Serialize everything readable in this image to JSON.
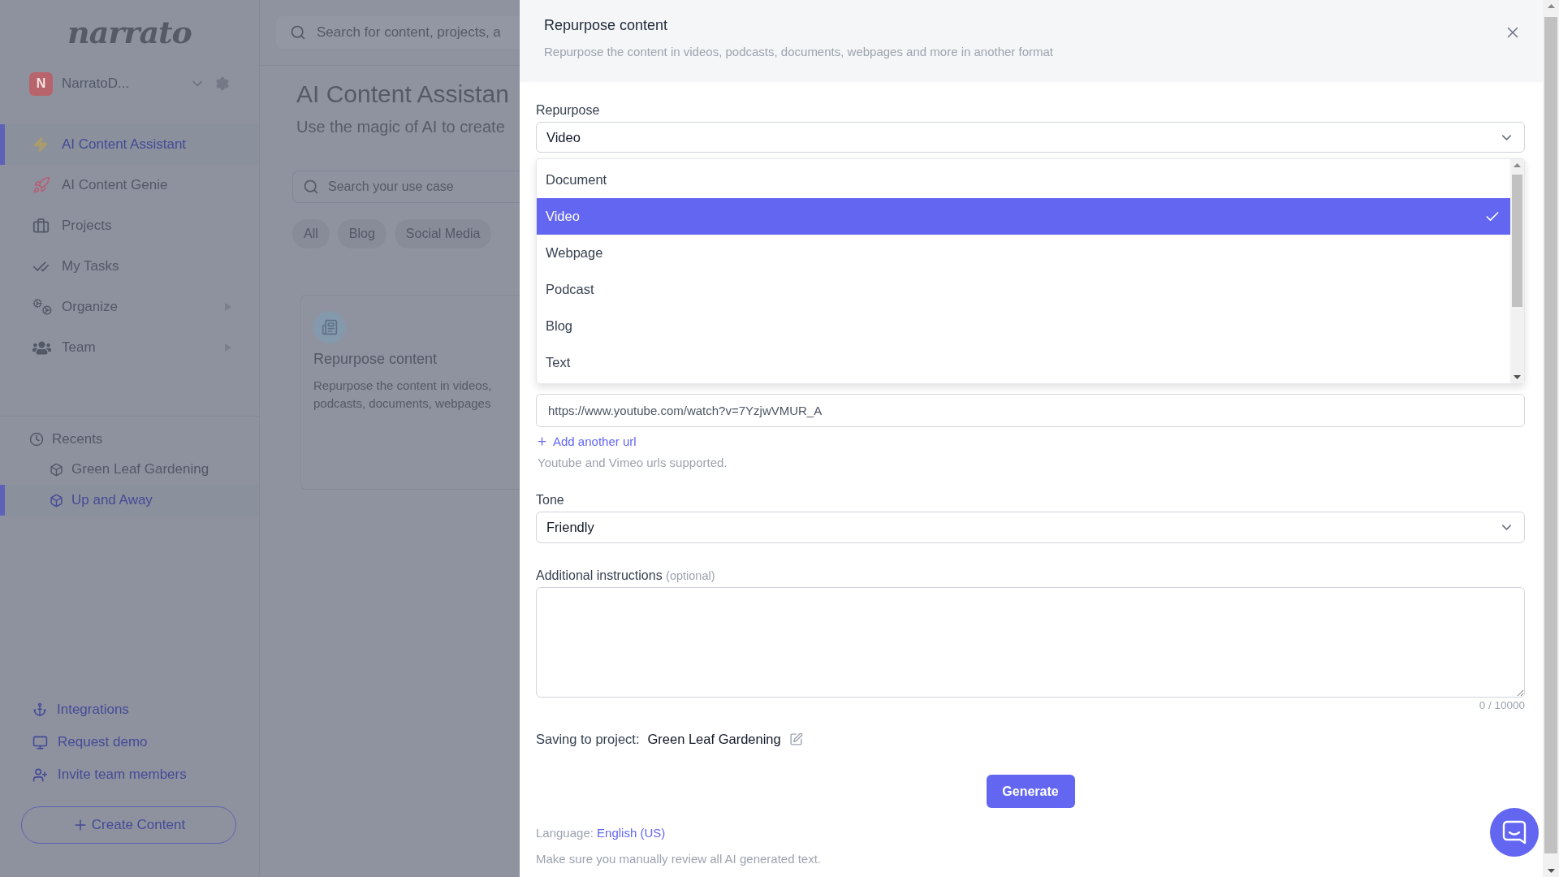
{
  "sidebar": {
    "logo": "narrato",
    "workspace": {
      "initial": "N",
      "name": "NarratoD..."
    },
    "nav": [
      {
        "label": "AI Content Assistant",
        "selected": true,
        "expandable": false
      },
      {
        "label": "AI Content Genie",
        "selected": false,
        "expandable": false
      },
      {
        "label": "Projects",
        "selected": false,
        "expandable": false
      },
      {
        "label": "My Tasks",
        "selected": false,
        "expandable": false
      },
      {
        "label": "Organize",
        "selected": false,
        "expandable": true
      },
      {
        "label": "Team",
        "selected": false,
        "expandable": true
      }
    ],
    "recents": {
      "title": "Recents",
      "items": [
        {
          "label": "Green Leaf Gardening",
          "selected": false
        },
        {
          "label": "Up and Away",
          "selected": true
        }
      ]
    },
    "links": [
      {
        "label": "Integrations"
      },
      {
        "label": "Request demo"
      },
      {
        "label": "Invite team members"
      }
    ],
    "create_button": "Create Content"
  },
  "main": {
    "search_placeholder": "Search for content, projects, a",
    "title": "AI Content Assistan",
    "subtitle": "Use the magic of AI to create",
    "usecase_search_placeholder": "Search your use case",
    "filters": [
      {
        "label": "All",
        "selected": false
      },
      {
        "label": "Blog",
        "selected": false
      },
      {
        "label": "Social Media",
        "selected": false
      }
    ],
    "card": {
      "title": "Repurpose content",
      "description": [
        "Repurpose the content in videos,",
        "podcasts, documents, webpages"
      ]
    }
  },
  "modal": {
    "title": "Repurpose content",
    "subtitle": "Repurpose the content in videos, podcasts, documents, webpages and more in another format",
    "repurpose": {
      "label": "Repurpose",
      "value": "Video",
      "expanded": true,
      "options": [
        {
          "label": "Document",
          "selected": false
        },
        {
          "label": "Video",
          "selected": true
        },
        {
          "label": "Webpage",
          "selected": false
        },
        {
          "label": "Podcast",
          "selected": false
        },
        {
          "label": "Blog",
          "selected": false
        },
        {
          "label": "Text",
          "selected": false
        }
      ]
    },
    "url": {
      "value": "https://www.youtube.com/watch?v=7YzjwVMUR_A"
    },
    "add_url": "Add another url",
    "url_hint": "Youtube and Vimeo urls supported.",
    "tone": {
      "label": "Tone",
      "value": "Friendly"
    },
    "instructions": {
      "label": "Additional instructions",
      "note": "(optional)",
      "counter": "0 / 10000"
    },
    "project": {
      "label": "Saving to project:",
      "value": "Green Leaf Gardening"
    },
    "generate": "Generate",
    "language": {
      "label": "Language:",
      "value": "English (US)"
    },
    "disclaimer": "Make sure you manually review all AI generated text."
  }
}
